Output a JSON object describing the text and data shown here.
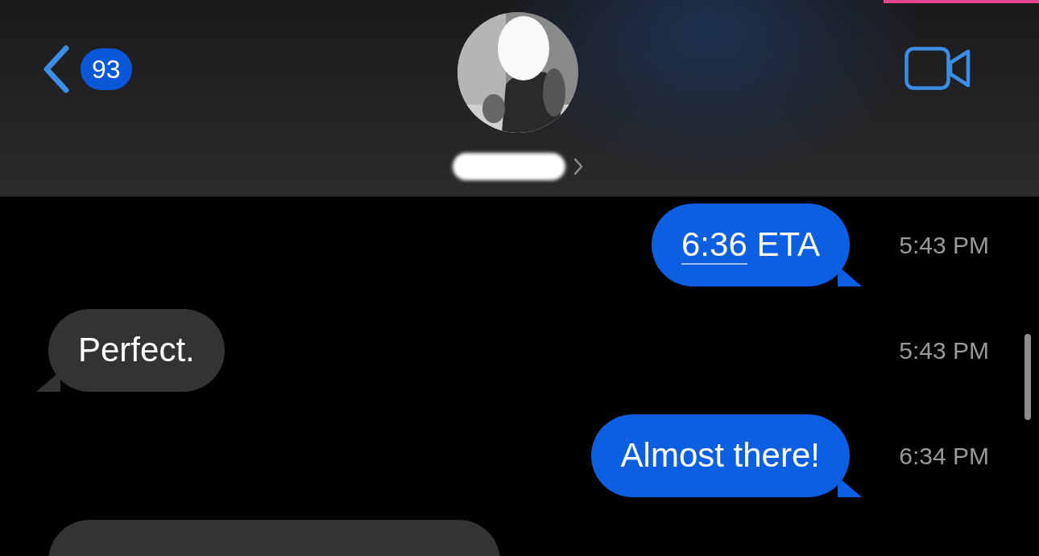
{
  "header": {
    "back_count": "93"
  },
  "messages": [
    {
      "kind": "sent",
      "parts": [
        {
          "text": "6:36",
          "link": true
        },
        {
          "text": " ETA",
          "link": false
        }
      ],
      "time": "5:43 PM"
    },
    {
      "kind": "received",
      "parts": [
        {
          "text": "Perfect.",
          "link": false
        }
      ],
      "time": "5:43 PM"
    },
    {
      "kind": "sent",
      "parts": [
        {
          "text": "Almost there!",
          "link": false
        }
      ],
      "time": "6:34 PM"
    },
    {
      "kind": "received_cut"
    }
  ]
}
